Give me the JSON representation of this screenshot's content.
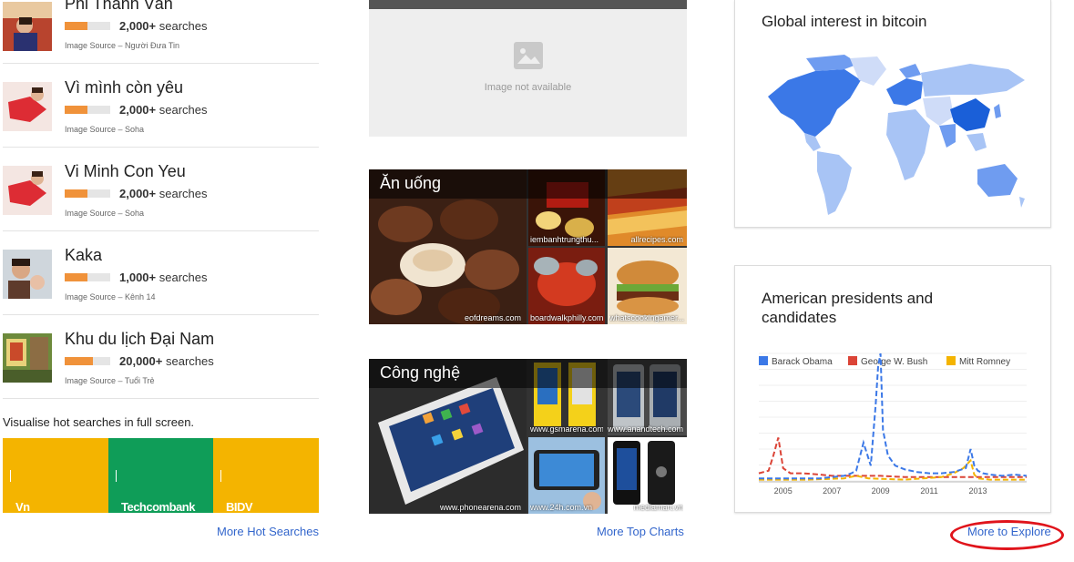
{
  "hot_searches": {
    "items": [
      {
        "title": "Phi Thanh Vân",
        "count": "2,000+",
        "searches_word": "searches",
        "source": "Image Source – Người Đưa Tin",
        "level": 0.5
      },
      {
        "title": "Vì mình còn yêu",
        "count": "2,000+",
        "searches_word": "searches",
        "source": "Image Source – Soha",
        "level": 0.5
      },
      {
        "title": "Vi Minh Con Yeu",
        "count": "2,000+",
        "searches_word": "searches",
        "source": "Image Source – Soha",
        "level": 0.5
      },
      {
        "title": "Kaka",
        "count": "1,000+",
        "searches_word": "searches",
        "source": "Image Source – Kênh 14",
        "level": 0.5
      },
      {
        "title": "Khu du lịch Đại Nam",
        "count": "20,000+",
        "searches_word": "searches",
        "source": "Image Source – Tuổi Trẻ",
        "level": 0.62
      }
    ],
    "visualise_text": "Visualise hot searches in full screen.",
    "tiles": [
      {
        "label": "Vn Sharing",
        "color": "#f4b400"
      },
      {
        "label": "Techcombank",
        "color": "#0f9d58"
      },
      {
        "label": "BIDV",
        "color": "#f4b400"
      }
    ],
    "more_label": "More Hot Searches"
  },
  "top_charts": {
    "image_not_available": "Image not available",
    "cards": [
      {
        "title": "Ăn uống",
        "main_caption": "eofdreams.com",
        "small_captions": [
          "iembanhtrungthu...",
          "allrecipes.com",
          "boardwalkphilly.com",
          "whatscookingamer..."
        ]
      },
      {
        "title": "Công nghệ",
        "main_caption": "www.phonearena.com",
        "small_captions": [
          "www.gsmarena.com",
          "www.anandtech.com",
          "www.24h.com.vn",
          "mediamart.vn"
        ]
      }
    ],
    "more_label": "More Top Charts"
  },
  "explore": {
    "map_card_title": "Global interest in bitcoin",
    "map_colors": {
      "dark": "#3b78e7",
      "mid": "#6f9cf0",
      "light": "#a8c4f5",
      "pale": "#cfdcf8"
    },
    "presidents_title_line1": "American presidents and",
    "presidents_title_line2": "candidates",
    "more_label": "More to Explore"
  },
  "chart_data": {
    "type": "line",
    "x_ticks": [
      "2005",
      "2007",
      "2009",
      "2011",
      "2013"
    ],
    "series": [
      {
        "name": "Barack Obama",
        "color": "#3b78e7",
        "x": [
          2004.0,
          2004.5,
          2005.0,
          2005.5,
          2006.0,
          2006.5,
          2007.0,
          2007.5,
          2007.8,
          2008.0,
          2008.3,
          2008.6,
          2008.8,
          2008.9,
          2009.0,
          2009.1,
          2009.3,
          2009.6,
          2010.0,
          2010.5,
          2011.0,
          2011.5,
          2012.0,
          2012.5,
          2012.7,
          2012.85,
          2013.0,
          2013.2,
          2013.5,
          2014.0,
          2014.5,
          2015.0
        ],
        "y": [
          2,
          2,
          2,
          2,
          2,
          2,
          3,
          4,
          6,
          8,
          30,
          12,
          60,
          90,
          100,
          40,
          20,
          12,
          9,
          7,
          6,
          6,
          7,
          10,
          25,
          12,
          8,
          6,
          5,
          4,
          5,
          4
        ]
      },
      {
        "name": "George W. Bush",
        "color": "#db4437",
        "x": [
          2004.0,
          2004.4,
          2004.6,
          2004.8,
          2005.0,
          2005.3,
          2005.8,
          2006.5,
          2007.0,
          2008.0,
          2009.0,
          2010.0,
          2011.0,
          2012.0,
          2013.0,
          2014.0,
          2015.0
        ],
        "y": [
          6,
          8,
          20,
          34,
          10,
          6,
          6,
          5,
          4,
          4,
          4,
          3,
          3,
          3,
          3,
          3,
          3
        ]
      },
      {
        "name": "Mitt Romney",
        "color": "#f4b400",
        "x": [
          2004.0,
          2006.0,
          2007.5,
          2008.0,
          2008.5,
          2010.0,
          2011.5,
          2012.0,
          2012.4,
          2012.7,
          2012.85,
          2013.0,
          2013.5,
          2014.0,
          2015.0
        ],
        "y": [
          1,
          1,
          2,
          4,
          2,
          1,
          3,
          6,
          10,
          16,
          5,
          2,
          1,
          1,
          1
        ]
      }
    ],
    "ylim": [
      0,
      100
    ],
    "xlim": [
      2004,
      2015
    ]
  }
}
